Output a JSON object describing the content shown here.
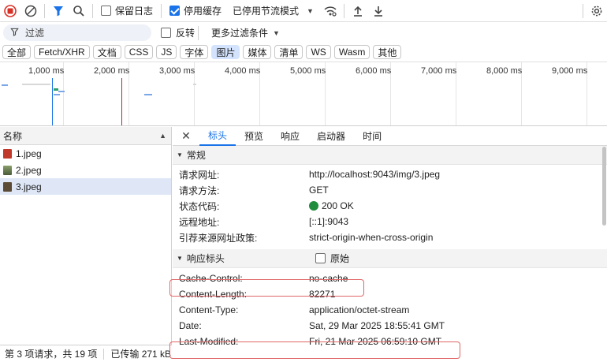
{
  "toolbar": {
    "preserve_log": "保留日志",
    "disable_cache": "停用缓存",
    "throttle": "已停用节流模式"
  },
  "filter": {
    "placeholder": "过滤",
    "invert": "反转",
    "more_filters": "更多过滤条件"
  },
  "types": [
    "全部",
    "Fetch/XHR",
    "文档",
    "CSS",
    "JS",
    "字体",
    "图片",
    "媒体",
    "清单",
    "WS",
    "Wasm",
    "其他"
  ],
  "active_type": "图片",
  "timeline": {
    "ticks": [
      "1,000 ms",
      "2,000 ms",
      "3,000 ms",
      "4,000 ms",
      "5,000 ms",
      "6,000 ms",
      "7,000 ms",
      "8,000 ms",
      "9,000 ms"
    ]
  },
  "requests": {
    "header": "名称",
    "items": [
      {
        "name": "1.jpeg",
        "thumb_color": "#c0392b"
      },
      {
        "name": "2.jpeg",
        "thumb_color": "#6d7f5a"
      },
      {
        "name": "3.jpeg",
        "thumb_color": "#5b4a36"
      }
    ],
    "selected": "3.jpeg"
  },
  "status_bar": {
    "requests": "第 3 项请求，共 19 项",
    "transferred": "已传输 271 kB"
  },
  "details": {
    "tabs": [
      "标头",
      "预览",
      "响应",
      "启动器",
      "时间"
    ],
    "active_tab": "标头",
    "general": {
      "title": "常规",
      "rows": [
        {
          "key": "请求网址:",
          "value": "http://localhost:9043/img/3.jpeg"
        },
        {
          "key": "请求方法:",
          "value": "GET"
        },
        {
          "key": "状态代码:",
          "value": "200 OK"
        },
        {
          "key": "远程地址:",
          "value": "[::1]:9043"
        },
        {
          "key": "引荐来源网址政策:",
          "value": "strict-origin-when-cross-origin"
        }
      ]
    },
    "response_headers": {
      "title": "响应标头",
      "raw_label": "原始",
      "rows": [
        {
          "key": "Cache-Control:",
          "value": "no-cache"
        },
        {
          "key": "Content-Length:",
          "value": "82271"
        },
        {
          "key": "Content-Type:",
          "value": "application/octet-stream"
        },
        {
          "key": "Date:",
          "value": "Sat, 29 Mar 2025 18:55:41 GMT"
        },
        {
          "key": "Last-Modified:",
          "value": "Fri, 21 Mar 2025 06:59:10 GMT"
        }
      ]
    }
  },
  "colors": {
    "accent": "#1a73e8",
    "record_red": "#d93025",
    "status_ok": "#1e8e3e",
    "highlight_box": "#e06666"
  }
}
